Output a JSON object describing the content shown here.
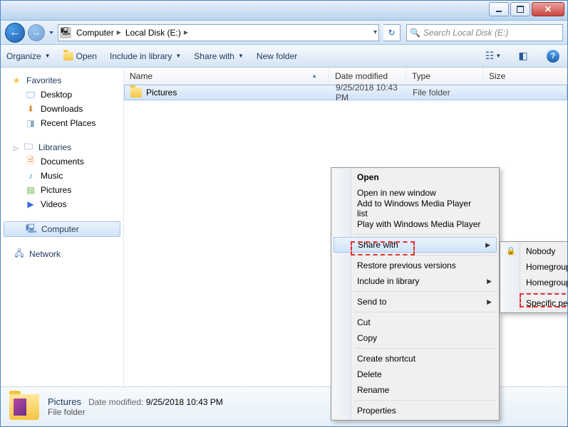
{
  "breadcrumb": {
    "seg1": "Computer",
    "seg2": "Local Disk (E:)"
  },
  "search": {
    "placeholder": "Search Local Disk (E:)"
  },
  "toolbar": {
    "organize": "Organize",
    "open": "Open",
    "include": "Include in library",
    "share": "Share with",
    "newfolder": "New folder"
  },
  "columns": {
    "name": "Name",
    "date": "Date modified",
    "type": "Type",
    "size": "Size"
  },
  "sidebar": {
    "favorites": "Favorites",
    "desktop": "Desktop",
    "downloads": "Downloads",
    "recent": "Recent Places",
    "libraries": "Libraries",
    "documents": "Documents",
    "music": "Music",
    "pictures": "Pictures",
    "videos": "Videos",
    "computer": "Computer",
    "network": "Network"
  },
  "rows": [
    {
      "name": "Pictures",
      "date": "9/25/2018 10:43 PM",
      "type": "File folder",
      "size": ""
    }
  ],
  "ctx": {
    "open": "Open",
    "open_new": "Open in new window",
    "add_wmp": "Add to Windows Media Player list",
    "play_wmp": "Play with Windows Media Player",
    "share_with": "Share with",
    "restore": "Restore previous versions",
    "include_lib": "Include in library",
    "send_to": "Send to",
    "cut": "Cut",
    "copy": "Copy",
    "shortcut": "Create shortcut",
    "delete": "Delete",
    "rename": "Rename",
    "properties": "Properties"
  },
  "ctx_sub": {
    "nobody": "Nobody",
    "hg_read": "Homegroup (Read)",
    "hg_rw": "Homegroup (Read/Write)",
    "specific": "Specific people..."
  },
  "details": {
    "name": "Pictures",
    "date_label": "Date modified:",
    "date": "9/25/2018 10:43 PM",
    "type": "File folder"
  }
}
